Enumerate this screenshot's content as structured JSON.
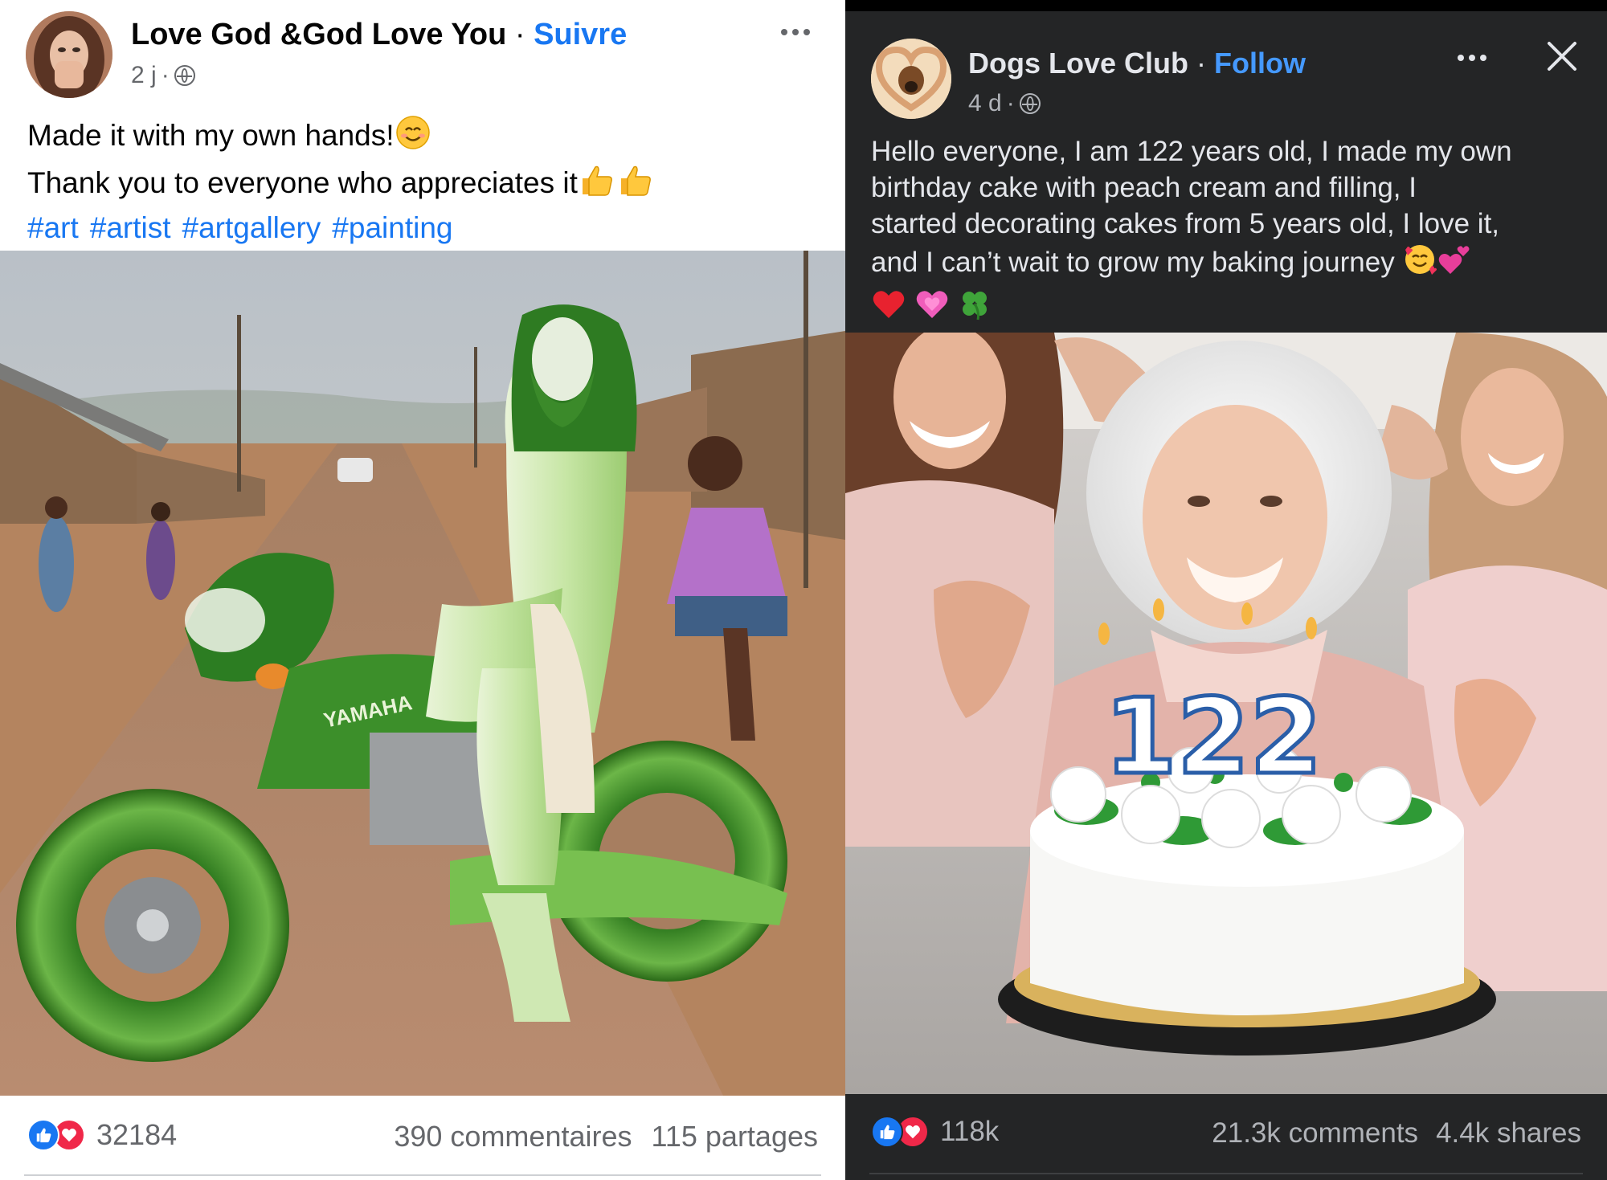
{
  "colors": {
    "link_blue": "#1877f2",
    "link_blue_dark": "#4599ff",
    "left_background": "#ffffff",
    "right_background": "#242526",
    "like_blue": "#1877f2",
    "love_red": "#f02849"
  },
  "left_post": {
    "author": "Love God &God Love You",
    "separator": "·",
    "follow_label": "Suivre",
    "age": "2 j",
    "privacy_icon": "globe-icon",
    "more_icon": "more-options-icon",
    "lines": [
      "Made it with my own hands!",
      "Thank you to everyone who appreciates it"
    ],
    "hashtags": [
      "#art",
      "#artist",
      "#artgallery",
      "#painting"
    ],
    "reactions_count": "32184",
    "comments": "390 commentaires",
    "shares": "115 partages",
    "image_text": "YAMAHA"
  },
  "right_post": {
    "author": "Dogs Love Club",
    "separator": "·",
    "follow_label": "Follow",
    "age": "4 d",
    "privacy_icon": "globe-icon",
    "more_icon": "more-options-icon",
    "close_icon": "close-icon",
    "lines": [
      "Hello everyone, I am 122 years old, I made my own",
      "birthday cake with peach cream and filling, I",
      "started decorating cakes from 5 years old, I love it,",
      "and I can’t wait to grow my baking journey"
    ],
    "reactions_count": "118k",
    "comments": "21.3k comments",
    "shares": "4.4k shares",
    "cake_number": "122"
  }
}
